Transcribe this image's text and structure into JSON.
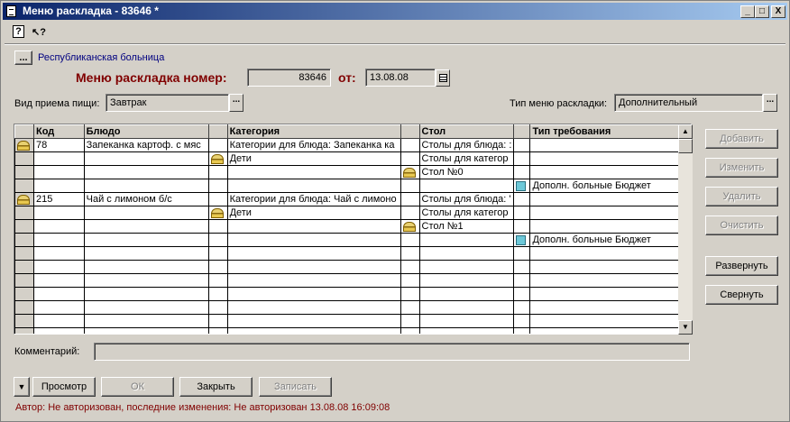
{
  "window": {
    "title": "Меню раскладка - 83646 *"
  },
  "title_buttons": {
    "min": "_",
    "max": "□",
    "close": "X"
  },
  "toolbar": {
    "help_icon": "?",
    "whatsthis_icon": "↖?"
  },
  "hospital": {
    "dots": "...",
    "name": "Республиканская больница"
  },
  "header": {
    "label": "Меню раскладка номер:",
    "number": "83646",
    "from_label": "от:",
    "date": "13.08.08"
  },
  "meal": {
    "label": "Вид приема пищи:",
    "value": "Завтрак",
    "dots": "..."
  },
  "menu_type": {
    "label": "Тип меню раскладки:",
    "value": "Дополнительный",
    "dots": "..."
  },
  "grid": {
    "headers": [
      "",
      "Код",
      "Блюдо",
      "",
      "Категория",
      "",
      "Стол",
      "",
      "Тип требования"
    ],
    "rows": [
      {
        "i0": "food",
        "code": "78",
        "dish": "Запеканка картоф. с мяс",
        "i3": "",
        "category": "Категории для блюда: Запеканка ка",
        "i5": "",
        "table": "Столы для блюда: :",
        "i7": "",
        "req": ""
      },
      {
        "i0": "",
        "code": "",
        "dish": "",
        "i3": "food",
        "category": "Дети",
        "i5": "",
        "table": "Столы для категор",
        "i7": "",
        "req": ""
      },
      {
        "i0": "",
        "code": "",
        "dish": "",
        "i3": "",
        "category": "",
        "i5": "food",
        "table": "Стол №0",
        "i7": "",
        "req": ""
      },
      {
        "i0": "",
        "code": "",
        "dish": "",
        "i3": "",
        "category": "",
        "i5": "",
        "table": "",
        "i7": "bldg",
        "req": "Дополн. больные Бюджет"
      },
      {
        "i0": "food",
        "code": "215",
        "dish": "Чай с лимоном б/с",
        "i3": "",
        "category": "Категории для блюда: Чай с лимоно",
        "i5": "",
        "table": "Столы для блюда: '",
        "i7": "",
        "req": ""
      },
      {
        "i0": "",
        "code": "",
        "dish": "",
        "i3": "food",
        "category": "Дети",
        "i5": "",
        "table": "Столы для категор",
        "i7": "",
        "req": ""
      },
      {
        "i0": "",
        "code": "",
        "dish": "",
        "i3": "",
        "category": "",
        "i5": "food",
        "table": "Стол №1",
        "i7": "",
        "req": ""
      },
      {
        "i0": "",
        "code": "",
        "dish": "",
        "i3": "",
        "category": "",
        "i5": "",
        "table": "",
        "i7": "bldg",
        "req": "Дополн. больные Бюджет"
      }
    ],
    "empty_rows": 7
  },
  "side_buttons": {
    "add": "Добавить",
    "edit": "Изменить",
    "delete": "Удалить",
    "clear": "Очистить",
    "expand": "Развернуть",
    "collapse": "Свернуть"
  },
  "comment": {
    "label": "Комментарий:",
    "value": ""
  },
  "bottom": {
    "arrow": "▼",
    "preview": "Просмотр",
    "ok": "ОК",
    "close": "Закрыть",
    "save": "Записать"
  },
  "status": "Автор: Не авторизован, последние изменения: Не авторизован 13.08.08 16:09:08"
}
